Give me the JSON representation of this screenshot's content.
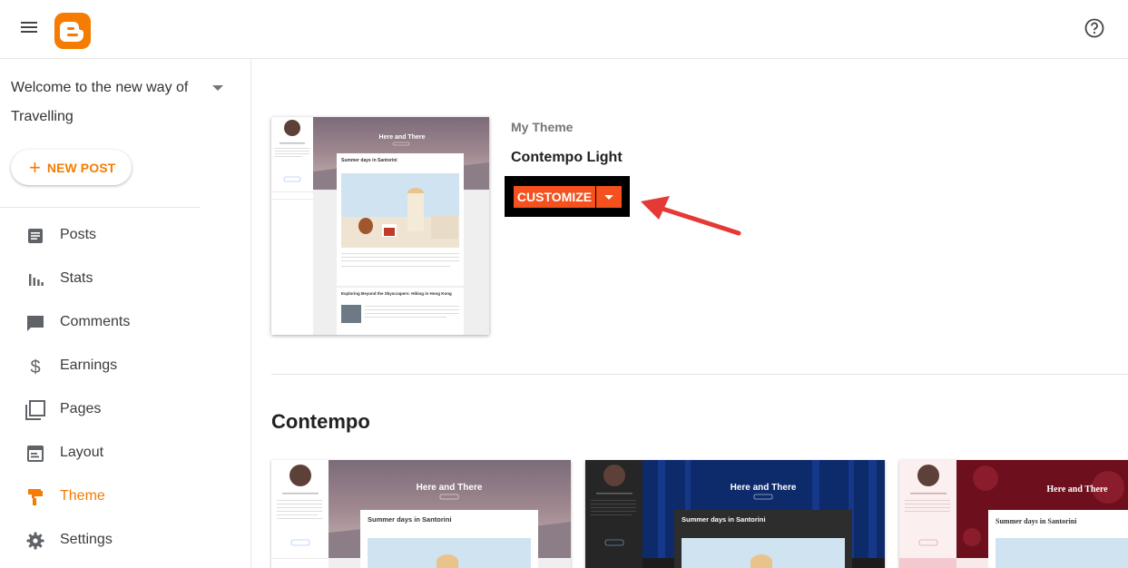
{
  "header": {
    "menu_icon": "hamburger-menu-icon",
    "logo_icon": "blogger-logo-icon",
    "help_icon": "help-circle-icon"
  },
  "sidebar": {
    "blog_title": "Welcome to the new way of Travelling",
    "new_post_label": "NEW POST",
    "items": [
      {
        "label": "Posts",
        "icon": "posts-icon"
      },
      {
        "label": "Stats",
        "icon": "stats-icon"
      },
      {
        "label": "Comments",
        "icon": "comments-icon"
      },
      {
        "label": "Earnings",
        "icon": "dollar-icon"
      },
      {
        "label": "Pages",
        "icon": "pages-icon"
      },
      {
        "label": "Layout",
        "icon": "layout-icon"
      },
      {
        "label": "Theme",
        "icon": "theme-icon",
        "active": true
      },
      {
        "label": "Settings",
        "icon": "gear-icon"
      }
    ]
  },
  "main": {
    "my_theme_label": "My Theme",
    "theme_name": "Contempo Light",
    "customize_label": "CUSTOMIZE",
    "section_title": "Contempo",
    "preview": {
      "blog_name": "Here and There",
      "post1_title": "Summer days in Santorini",
      "post2_title": "Exploring Beyond the Skyscrapers: Hiking in Hong Kong"
    },
    "gallery": [
      {
        "blog_name": "Here and There",
        "post_title": "Summer days in Santorini",
        "variant": "light"
      },
      {
        "blog_name": "Here and There",
        "post_title": "Summer days in Santorini",
        "variant": "dark"
      },
      {
        "blog_name": "Here and There",
        "post_title": "Summer days in Santorini",
        "variant": "rose"
      }
    ]
  },
  "colors": {
    "accent": "#f57c00",
    "customize": "#f4511e",
    "annotation_arrow": "#e53935"
  }
}
